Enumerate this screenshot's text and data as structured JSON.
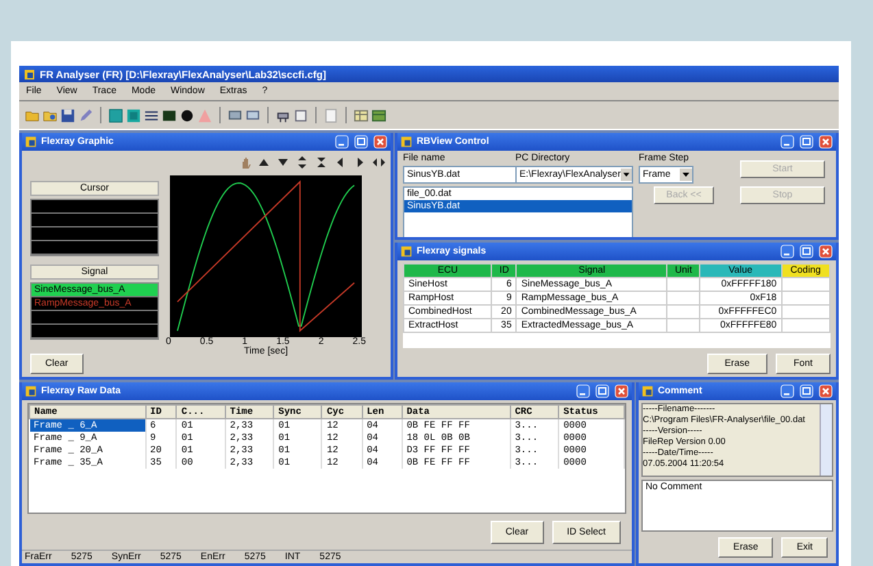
{
  "app": {
    "title": "FR Analyser (FR) [D:\\Flexray\\FlexAnalyser\\Lab32\\sccfi.cfg]",
    "menu": [
      "File",
      "View",
      "Trace",
      "Mode",
      "Window",
      "Extras",
      "?"
    ]
  },
  "graphic": {
    "title": "Flexray Graphic",
    "cursor_header": "Cursor",
    "signal_header": "Signal",
    "signals": [
      {
        "name": "SineMessage_bus_A",
        "kind": "sine",
        "color": "#20d050",
        "selected": true
      },
      {
        "name": "RampMessage_bus_A",
        "kind": "ramp",
        "color": "#c83a28",
        "selected": false
      }
    ],
    "clear_button": "Clear",
    "x_ticks": [
      "0",
      "0.5",
      "1",
      "1.5",
      "2",
      "2.5"
    ],
    "x_label": "Time [sec]"
  },
  "rbview": {
    "title": "RBView Control",
    "file_label": "File name",
    "file_value": "SinusYB.dat",
    "files": [
      {
        "name": "file_00.dat",
        "selected": false
      },
      {
        "name": "SinusYB.dat",
        "selected": true
      }
    ],
    "dir_label": "PC Directory",
    "dir_value": "E:\\Flexray\\FlexAnalyser",
    "step_label": "Frame Step",
    "step_value": "Frame",
    "start_button": {
      "label": "Start",
      "disabled": true
    },
    "back_button": {
      "label": "Back <<",
      "disabled": true
    },
    "stop_button": {
      "label": "Stop",
      "disabled": true
    }
  },
  "signals": {
    "title": "Flexray signals",
    "columns": [
      {
        "label": "ECU",
        "color": "#1fb84a"
      },
      {
        "label": "ID",
        "color": "#1fb84a"
      },
      {
        "label": "Signal",
        "color": "#1fb84a"
      },
      {
        "label": "Unit",
        "color": "#1fb84a"
      },
      {
        "label": "Value",
        "color": "#2ab8b8"
      },
      {
        "label": "Coding",
        "color": "#f0e020"
      }
    ],
    "rows": [
      [
        "SineHost",
        "6",
        "SineMessage_bus_A",
        "",
        "0xFFFFF180",
        ""
      ],
      [
        "RampHost",
        "9",
        "RampMessage_bus_A",
        "",
        "0xF18",
        ""
      ],
      [
        "CombinedHost",
        "20",
        "CombinedMessage_bus_A",
        "",
        "0xFFFFFEC0",
        ""
      ],
      [
        "ExtractHost",
        "35",
        "ExtractedMessage_bus_A",
        "",
        "0xFFFFFE80",
        ""
      ]
    ],
    "buttons": [
      "Erase",
      "Font"
    ]
  },
  "raw": {
    "title": "Flexray Raw Data",
    "columns": [
      "Name",
      "ID",
      "C...",
      "Time",
      "Sync",
      "Cyc",
      "Len",
      "Data",
      "CRC",
      "Status"
    ],
    "rows": [
      {
        "selected": true,
        "cells": [
          "Frame _ 6_A",
          "6",
          "01",
          "2,33",
          "01",
          "12",
          "04",
          "0B FE FF FF",
          "3...",
          "0000"
        ]
      },
      {
        "selected": false,
        "cells": [
          "Frame _ 9_A",
          "9",
          "01",
          "2,33",
          "01",
          "12",
          "04",
          "18 0L 0B 0B",
          "3...",
          "0000"
        ]
      },
      {
        "selected": false,
        "cells": [
          "Frame _ 20_A",
          "20",
          "01",
          "2,33",
          "01",
          "12",
          "04",
          "D3 FF FF FF",
          "3...",
          "0000"
        ]
      },
      {
        "selected": false,
        "cells": [
          "Frame _ 35_A",
          "35",
          "00",
          "2,33",
          "01",
          "12",
          "04",
          "0B FE FF FF",
          "3...",
          "0000"
        ]
      }
    ],
    "buttons": [
      "Clear",
      "ID Select"
    ],
    "status": [
      {
        "label": "FraErr",
        "value": "5275"
      },
      {
        "label": "SynErr",
        "value": "5275"
      },
      {
        "label": "EnErr",
        "value": "5275"
      },
      {
        "label": "INT",
        "value": "5275"
      }
    ]
  },
  "comment": {
    "title": "Comment",
    "lines": [
      "-----Filename-------",
      "C:\\Program Files\\FR-Analyser\\file_00.dat",
      "-----Version-----",
      "FileRep Version 0.00",
      "-----Date/Time-----",
      "07.05.2004 11:20:54"
    ],
    "note": "No Comment",
    "buttons": [
      "Erase",
      "Exit"
    ]
  }
}
